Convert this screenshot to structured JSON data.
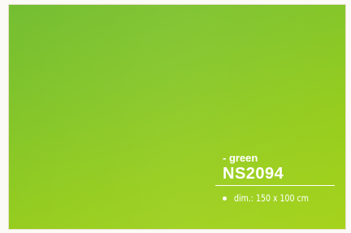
{
  "product": {
    "variant_label": "- green",
    "code": "NS2094",
    "spec_bullet": "dim.: 150 x 100 cm",
    "panel_color": "#8fc924"
  }
}
